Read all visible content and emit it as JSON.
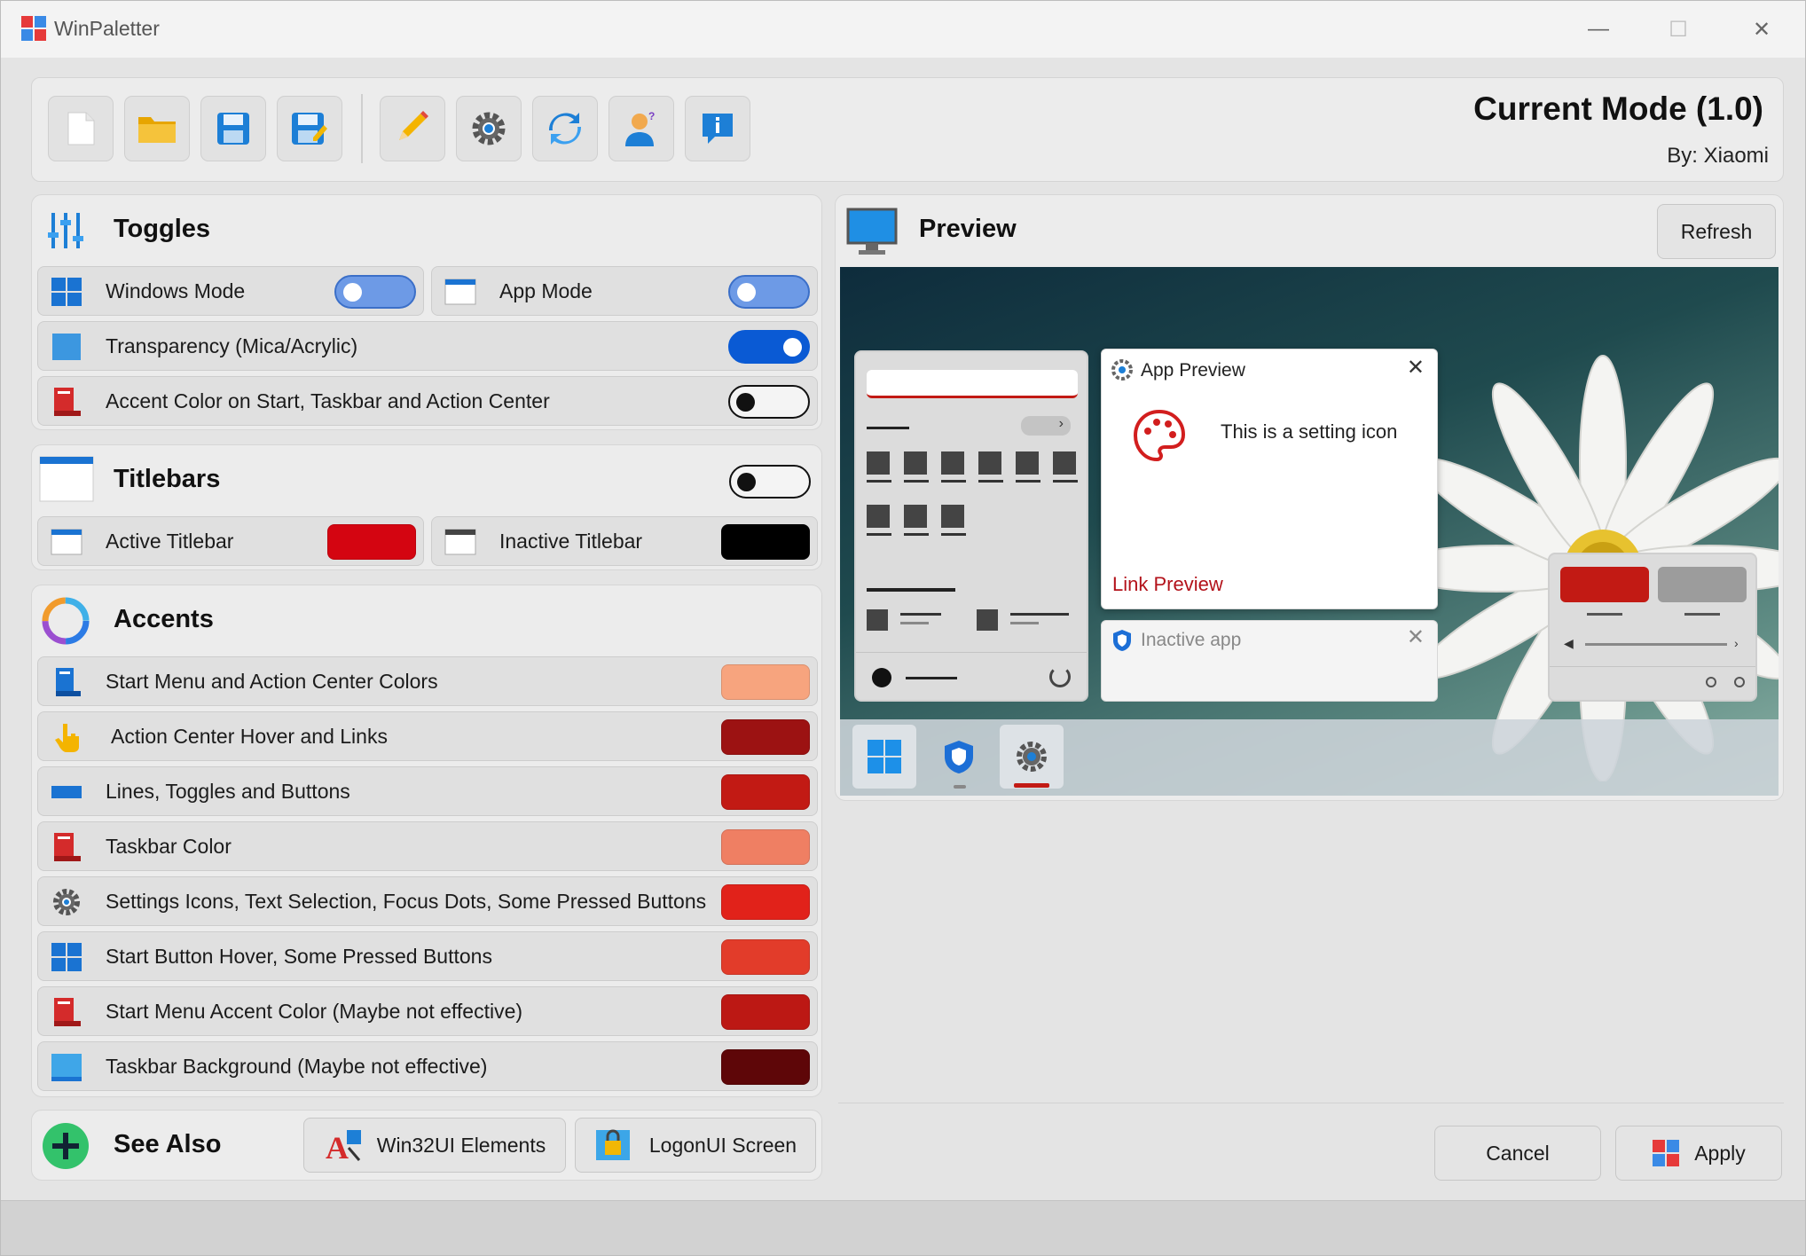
{
  "window": {
    "title": "WinPaletter",
    "minimize": "—",
    "maximize": "☐",
    "close": "✕"
  },
  "toolbar": {
    "buttons": [
      "new-file-icon",
      "open-folder-icon",
      "save-icon",
      "save-as-icon",
      "edit-pencil-icon",
      "settings-gear-icon",
      "update-sync-icon",
      "about-user-icon",
      "info-icon"
    ]
  },
  "mode": {
    "title": "Current Mode (1.0)",
    "author": "By: Xiaomi"
  },
  "toggles": {
    "title": "Toggles",
    "windows_mode": {
      "label": "Windows Mode",
      "state": "light"
    },
    "app_mode": {
      "label": "App Mode",
      "state": "light"
    },
    "transparency": {
      "label": "Transparency (Mica/Acrylic)",
      "state": true
    },
    "accent_on_start": {
      "label": "Accent Color on Start, Taskbar and Action Center",
      "state": false
    }
  },
  "titlebars": {
    "title": "Titlebars",
    "enabled": false,
    "active": {
      "label": "Active Titlebar",
      "color": "#d40511"
    },
    "inactive": {
      "label": "Inactive Titlebar",
      "color": "#000000"
    }
  },
  "accents": {
    "title": "Accents",
    "items": [
      {
        "label": "Start Menu and Action Center Colors",
        "color": "#f7a47e",
        "icon": "start-menu-icon"
      },
      {
        "label": "Action Center Hover and Links",
        "color": "#9c1212",
        "icon": "pointer-hand-icon"
      },
      {
        "label": "Lines, Toggles and Buttons",
        "color": "#c21a14",
        "icon": "line-icon"
      },
      {
        "label": "Taskbar Color",
        "color": "#ef7f63",
        "icon": "taskbar-icon"
      },
      {
        "label": "Settings Icons, Text Selection, Focus Dots, Some Pressed Buttons",
        "color": "#e1221a",
        "icon": "gear-icon"
      },
      {
        "label": "Start Button Hover, Some Pressed Buttons",
        "color": "#e23c2a",
        "icon": "windows-logo-icon"
      },
      {
        "label": "Start Menu Accent Color (Maybe not effective)",
        "color": "#bc1814",
        "icon": "start-menu-accent-icon"
      },
      {
        "label": "Taskbar Background (Maybe not effective)",
        "color": "#5e0608",
        "icon": "taskbar-bg-icon"
      }
    ]
  },
  "see_also": {
    "title": "See Also",
    "win32": "Win32UI Elements",
    "logonui": "LogonUI Screen"
  },
  "preview": {
    "title": "Preview",
    "refresh": "Refresh",
    "app_preview_title": "App Preview",
    "setting_text": "This is a setting icon",
    "link_text": "Link Preview",
    "inactive_title": "Inactive app"
  },
  "actions": {
    "cancel": "Cancel",
    "apply": "Apply"
  },
  "colors": {
    "accent_blue": "#0a5ad4",
    "link_red": "#b3121a"
  }
}
